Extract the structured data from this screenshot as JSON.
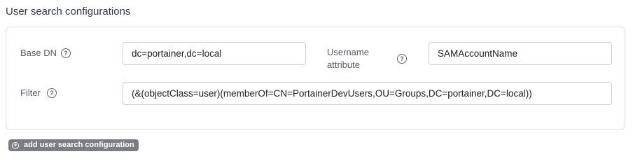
{
  "section": {
    "title": "User search configurations"
  },
  "fields": {
    "base_dn": {
      "label": "Base DN",
      "value": "dc=portainer,dc=local"
    },
    "username_attribute": {
      "label_line1": "Username",
      "label_line2": "attribute",
      "value": "SAMAccountName"
    },
    "filter": {
      "label": "Filter",
      "value": "(&(objectClass=user)(memberOf=CN=PortainerDevUsers,OU=Groups,DC=portainer,DC=local))"
    }
  },
  "help_icon_glyph": "?",
  "add_button": {
    "icon_glyph": "+",
    "label": "add user search configuration"
  },
  "colors": {
    "border": "#d9dde3",
    "button_bg": "#7b7d82"
  }
}
